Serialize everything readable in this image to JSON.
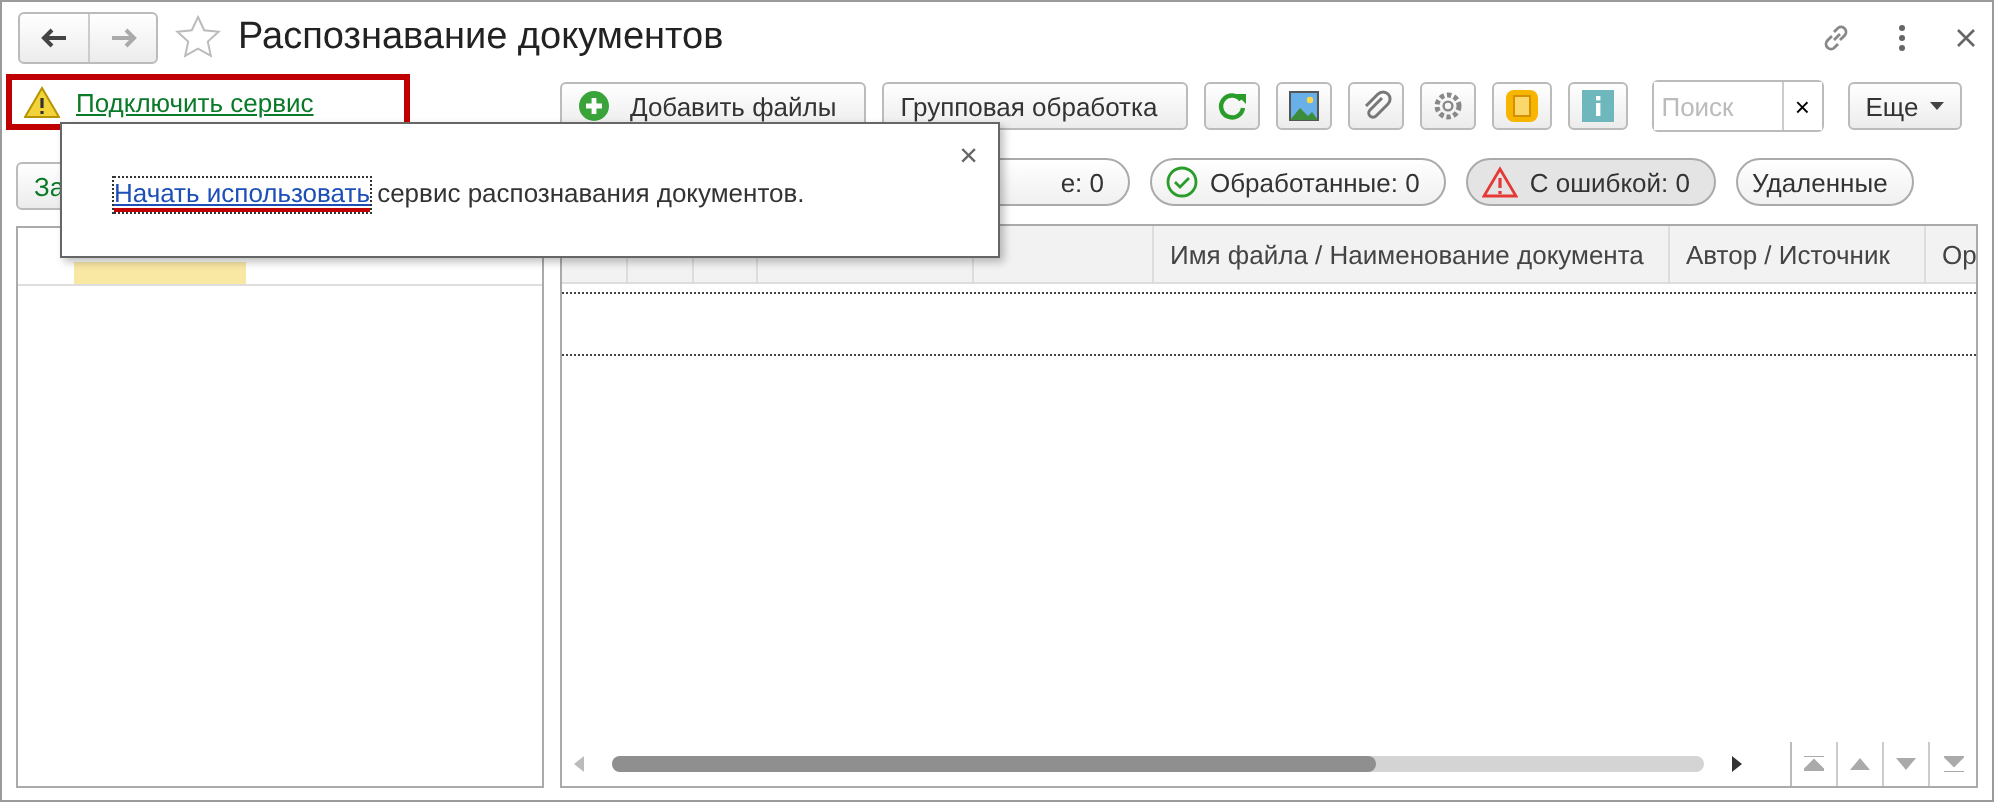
{
  "window": {
    "title": "Распознавание документов",
    "favorite": false
  },
  "service_link": "Подключить сервис",
  "left_button": "За",
  "toolbar": {
    "buttons": [
      {
        "kind": "add",
        "label": "Добавить файлы"
      },
      {
        "kind": "text",
        "label": "Групповая обработка"
      },
      {
        "kind": "refresh"
      },
      {
        "kind": "image"
      },
      {
        "kind": "attach"
      },
      {
        "kind": "settings"
      },
      {
        "kind": "scan"
      },
      {
        "kind": "info"
      }
    ],
    "search": {
      "placeholder": "Поиск"
    },
    "clear": "×",
    "more": "Еще"
  },
  "filters": [
    {
      "label": "е: 0",
      "kind": "plain",
      "selected": false
    },
    {
      "label": "Обработанные: 0",
      "kind": "ok",
      "selected": false
    },
    {
      "label": "С ошибкой: 0",
      "kind": "error",
      "selected": true
    },
    {
      "label": "Удаленные",
      "kind": "plain",
      "selected": false
    }
  ],
  "table": {
    "columns": [
      {},
      {},
      {},
      {},
      {},
      {
        "label": "Имя файла / Наименование документа"
      },
      {
        "label": "Автор / Источник"
      },
      {
        "label": "Ор"
      }
    ]
  },
  "popup": {
    "link": "Начать использовать",
    "text": " сервис распознавания документов.",
    "close": "×"
  }
}
